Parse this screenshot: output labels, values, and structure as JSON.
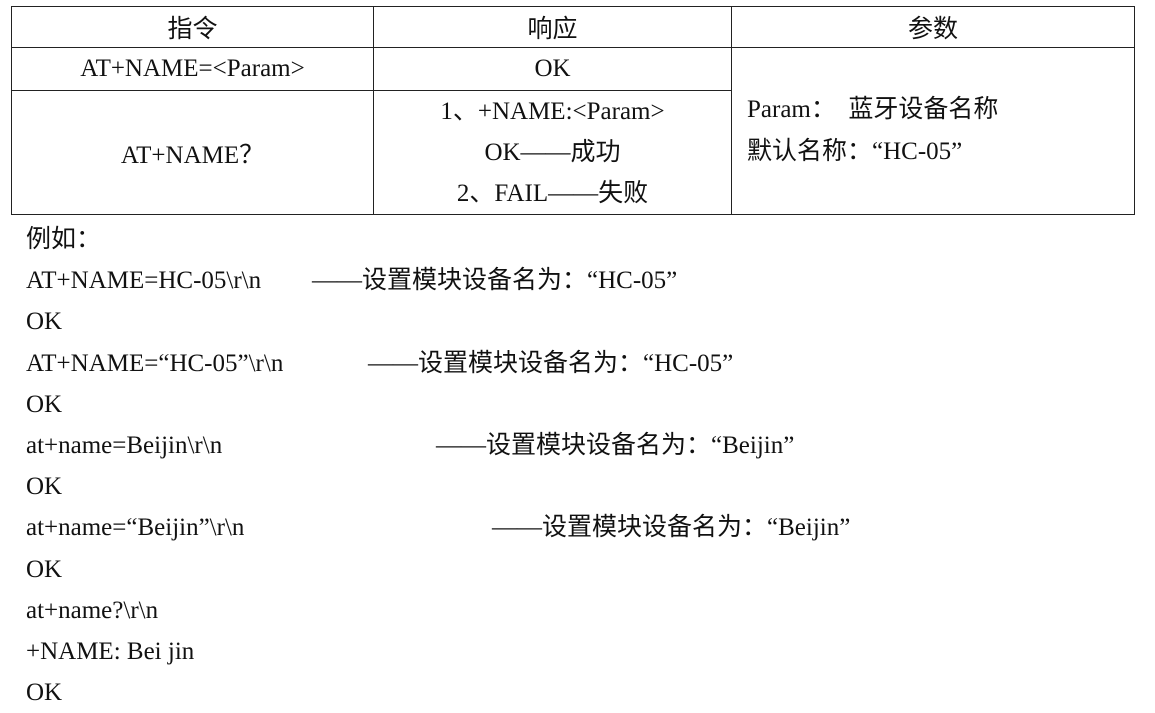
{
  "table": {
    "headers": [
      "指令",
      "响应",
      "参数"
    ],
    "rows": [
      {
        "command": "AT+NAME=<Param>",
        "response": [
          "OK"
        ]
      },
      {
        "command": "AT+NAME？",
        "response": [
          "1、+NAME:<Param>",
          "OK——成功",
          "2、FAIL——失败"
        ]
      }
    ],
    "params": [
      "Param：  蓝牙设备名称",
      "默认名称：“HC-05”"
    ]
  },
  "examples": {
    "title": "例如：",
    "lines": [
      {
        "cmd": "AT+NAME=HC-05\\r\\n",
        "note": "——设置模块设备名为：“HC-05”"
      },
      {
        "cmd": "OK"
      },
      {
        "cmd": "AT+NAME=“HC-05”\\r\\n",
        "note": "——设置模块设备名为：“HC-05”"
      },
      {
        "cmd": "OK"
      },
      {
        "cmd": "at+name=Beijin\\r\\n",
        "note": "——设置模块设备名为：“Beijin”"
      },
      {
        "cmd": "OK"
      },
      {
        "cmd": "at+name=“Beijin”\\r\\n",
        "note": "——设置模块设备名为：“Beijin”"
      },
      {
        "cmd": "OK"
      },
      {
        "cmd": "at+name?\\r\\n"
      },
      {
        "cmd": "+NAME: Bei jin"
      },
      {
        "cmd": "OK"
      }
    ]
  }
}
